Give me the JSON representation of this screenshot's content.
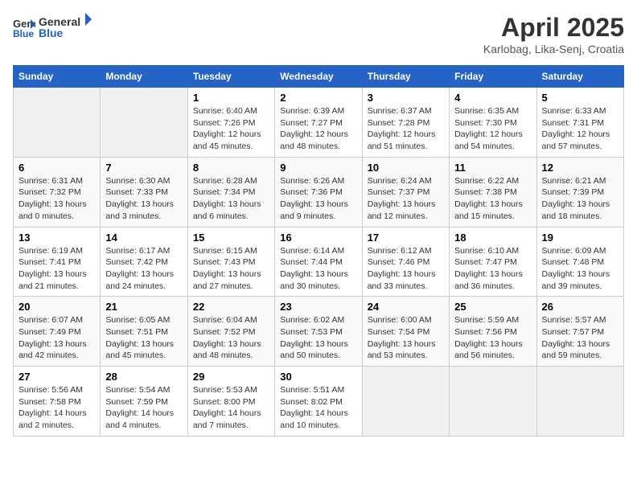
{
  "header": {
    "logo_line1": "General",
    "logo_line2": "Blue",
    "month_title": "April 2025",
    "subtitle": "Karlobag, Lika-Senj, Croatia"
  },
  "weekdays": [
    "Sunday",
    "Monday",
    "Tuesday",
    "Wednesday",
    "Thursday",
    "Friday",
    "Saturday"
  ],
  "weeks": [
    [
      {
        "day": "",
        "info": ""
      },
      {
        "day": "",
        "info": ""
      },
      {
        "day": "1",
        "info": "Sunrise: 6:40 AM\nSunset: 7:26 PM\nDaylight: 12 hours\nand 45 minutes."
      },
      {
        "day": "2",
        "info": "Sunrise: 6:39 AM\nSunset: 7:27 PM\nDaylight: 12 hours\nand 48 minutes."
      },
      {
        "day": "3",
        "info": "Sunrise: 6:37 AM\nSunset: 7:28 PM\nDaylight: 12 hours\nand 51 minutes."
      },
      {
        "day": "4",
        "info": "Sunrise: 6:35 AM\nSunset: 7:30 PM\nDaylight: 12 hours\nand 54 minutes."
      },
      {
        "day": "5",
        "info": "Sunrise: 6:33 AM\nSunset: 7:31 PM\nDaylight: 12 hours\nand 57 minutes."
      }
    ],
    [
      {
        "day": "6",
        "info": "Sunrise: 6:31 AM\nSunset: 7:32 PM\nDaylight: 13 hours\nand 0 minutes."
      },
      {
        "day": "7",
        "info": "Sunrise: 6:30 AM\nSunset: 7:33 PM\nDaylight: 13 hours\nand 3 minutes."
      },
      {
        "day": "8",
        "info": "Sunrise: 6:28 AM\nSunset: 7:34 PM\nDaylight: 13 hours\nand 6 minutes."
      },
      {
        "day": "9",
        "info": "Sunrise: 6:26 AM\nSunset: 7:36 PM\nDaylight: 13 hours\nand 9 minutes."
      },
      {
        "day": "10",
        "info": "Sunrise: 6:24 AM\nSunset: 7:37 PM\nDaylight: 13 hours\nand 12 minutes."
      },
      {
        "day": "11",
        "info": "Sunrise: 6:22 AM\nSunset: 7:38 PM\nDaylight: 13 hours\nand 15 minutes."
      },
      {
        "day": "12",
        "info": "Sunrise: 6:21 AM\nSunset: 7:39 PM\nDaylight: 13 hours\nand 18 minutes."
      }
    ],
    [
      {
        "day": "13",
        "info": "Sunrise: 6:19 AM\nSunset: 7:41 PM\nDaylight: 13 hours\nand 21 minutes."
      },
      {
        "day": "14",
        "info": "Sunrise: 6:17 AM\nSunset: 7:42 PM\nDaylight: 13 hours\nand 24 minutes."
      },
      {
        "day": "15",
        "info": "Sunrise: 6:15 AM\nSunset: 7:43 PM\nDaylight: 13 hours\nand 27 minutes."
      },
      {
        "day": "16",
        "info": "Sunrise: 6:14 AM\nSunset: 7:44 PM\nDaylight: 13 hours\nand 30 minutes."
      },
      {
        "day": "17",
        "info": "Sunrise: 6:12 AM\nSunset: 7:46 PM\nDaylight: 13 hours\nand 33 minutes."
      },
      {
        "day": "18",
        "info": "Sunrise: 6:10 AM\nSunset: 7:47 PM\nDaylight: 13 hours\nand 36 minutes."
      },
      {
        "day": "19",
        "info": "Sunrise: 6:09 AM\nSunset: 7:48 PM\nDaylight: 13 hours\nand 39 minutes."
      }
    ],
    [
      {
        "day": "20",
        "info": "Sunrise: 6:07 AM\nSunset: 7:49 PM\nDaylight: 13 hours\nand 42 minutes."
      },
      {
        "day": "21",
        "info": "Sunrise: 6:05 AM\nSunset: 7:51 PM\nDaylight: 13 hours\nand 45 minutes."
      },
      {
        "day": "22",
        "info": "Sunrise: 6:04 AM\nSunset: 7:52 PM\nDaylight: 13 hours\nand 48 minutes."
      },
      {
        "day": "23",
        "info": "Sunrise: 6:02 AM\nSunset: 7:53 PM\nDaylight: 13 hours\nand 50 minutes."
      },
      {
        "day": "24",
        "info": "Sunrise: 6:00 AM\nSunset: 7:54 PM\nDaylight: 13 hours\nand 53 minutes."
      },
      {
        "day": "25",
        "info": "Sunrise: 5:59 AM\nSunset: 7:56 PM\nDaylight: 13 hours\nand 56 minutes."
      },
      {
        "day": "26",
        "info": "Sunrise: 5:57 AM\nSunset: 7:57 PM\nDaylight: 13 hours\nand 59 minutes."
      }
    ],
    [
      {
        "day": "27",
        "info": "Sunrise: 5:56 AM\nSunset: 7:58 PM\nDaylight: 14 hours\nand 2 minutes."
      },
      {
        "day": "28",
        "info": "Sunrise: 5:54 AM\nSunset: 7:59 PM\nDaylight: 14 hours\nand 4 minutes."
      },
      {
        "day": "29",
        "info": "Sunrise: 5:53 AM\nSunset: 8:00 PM\nDaylight: 14 hours\nand 7 minutes."
      },
      {
        "day": "30",
        "info": "Sunrise: 5:51 AM\nSunset: 8:02 PM\nDaylight: 14 hours\nand 10 minutes."
      },
      {
        "day": "",
        "info": ""
      },
      {
        "day": "",
        "info": ""
      },
      {
        "day": "",
        "info": ""
      }
    ]
  ]
}
